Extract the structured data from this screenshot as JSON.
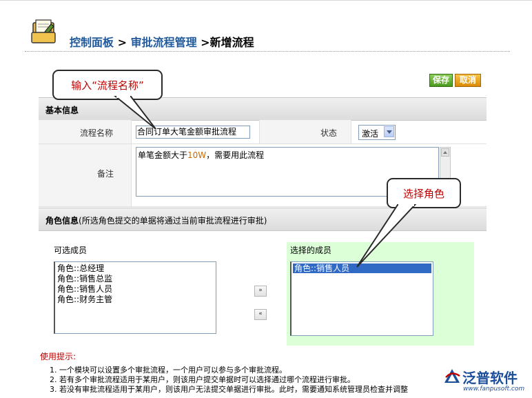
{
  "breadcrumb": {
    "control_panel": "控制面板",
    "sep1": " > ",
    "approval_mgmt": "审批流程管理",
    "sep2": " >",
    "current": "新增流程"
  },
  "callouts": {
    "enter_name": "输入“流程名称”",
    "choose_role": "选择角色"
  },
  "actions": {
    "save": "保存",
    "cancel": "取消"
  },
  "basic_info": {
    "title": "基本信息",
    "name_label": "流程名称",
    "name_value": "合同订单大笔金额审批流程",
    "status_label": "状态",
    "status_value": "激活",
    "remark_label": "备注",
    "remark_prefix": "单笔金额大于",
    "remark_number": "10W",
    "remark_suffix": "，需要用此流程"
  },
  "role_info": {
    "title": "角色信息",
    "note": "(所选角色提交的单据将通过当前审批流程进行审批)",
    "available_title": "可选成员",
    "available": [
      "角色::总经理",
      "角色::销售总监",
      "角色::销售人员",
      "角色::财务主管"
    ],
    "move_right": "»",
    "move_left": "«",
    "selected_title": "选择的成员",
    "selected": [
      "角色::销售人员"
    ]
  },
  "tips": {
    "title": "使用提示:",
    "items": [
      "1. 一个模块可以设置多个审批流程，一个用户可以参与多个审批流程。",
      "2. 若有多个审批流程适用于某用户，则该用户提交单据时可以选择通过哪个流程进行审批。",
      "3. 若没有审批流程适用于某用户，则该用户无法提交单据进行审批。此时，需要通知系统管理员检查并调整"
    ]
  },
  "brand": {
    "name": "泛普软件",
    "url": "www.fanpusoft.com"
  },
  "icons": {
    "logo": "control-panel-folder-icon",
    "brand": "fanpu-logo-icon"
  },
  "colors": {
    "breadcrumb_link": "#215a9c",
    "callout_text": "#c00000",
    "save_button": "#4a9a1e",
    "cancel_button": "#d98a08",
    "selected_panel": "#dcffd8",
    "selection": "#316ac5"
  }
}
